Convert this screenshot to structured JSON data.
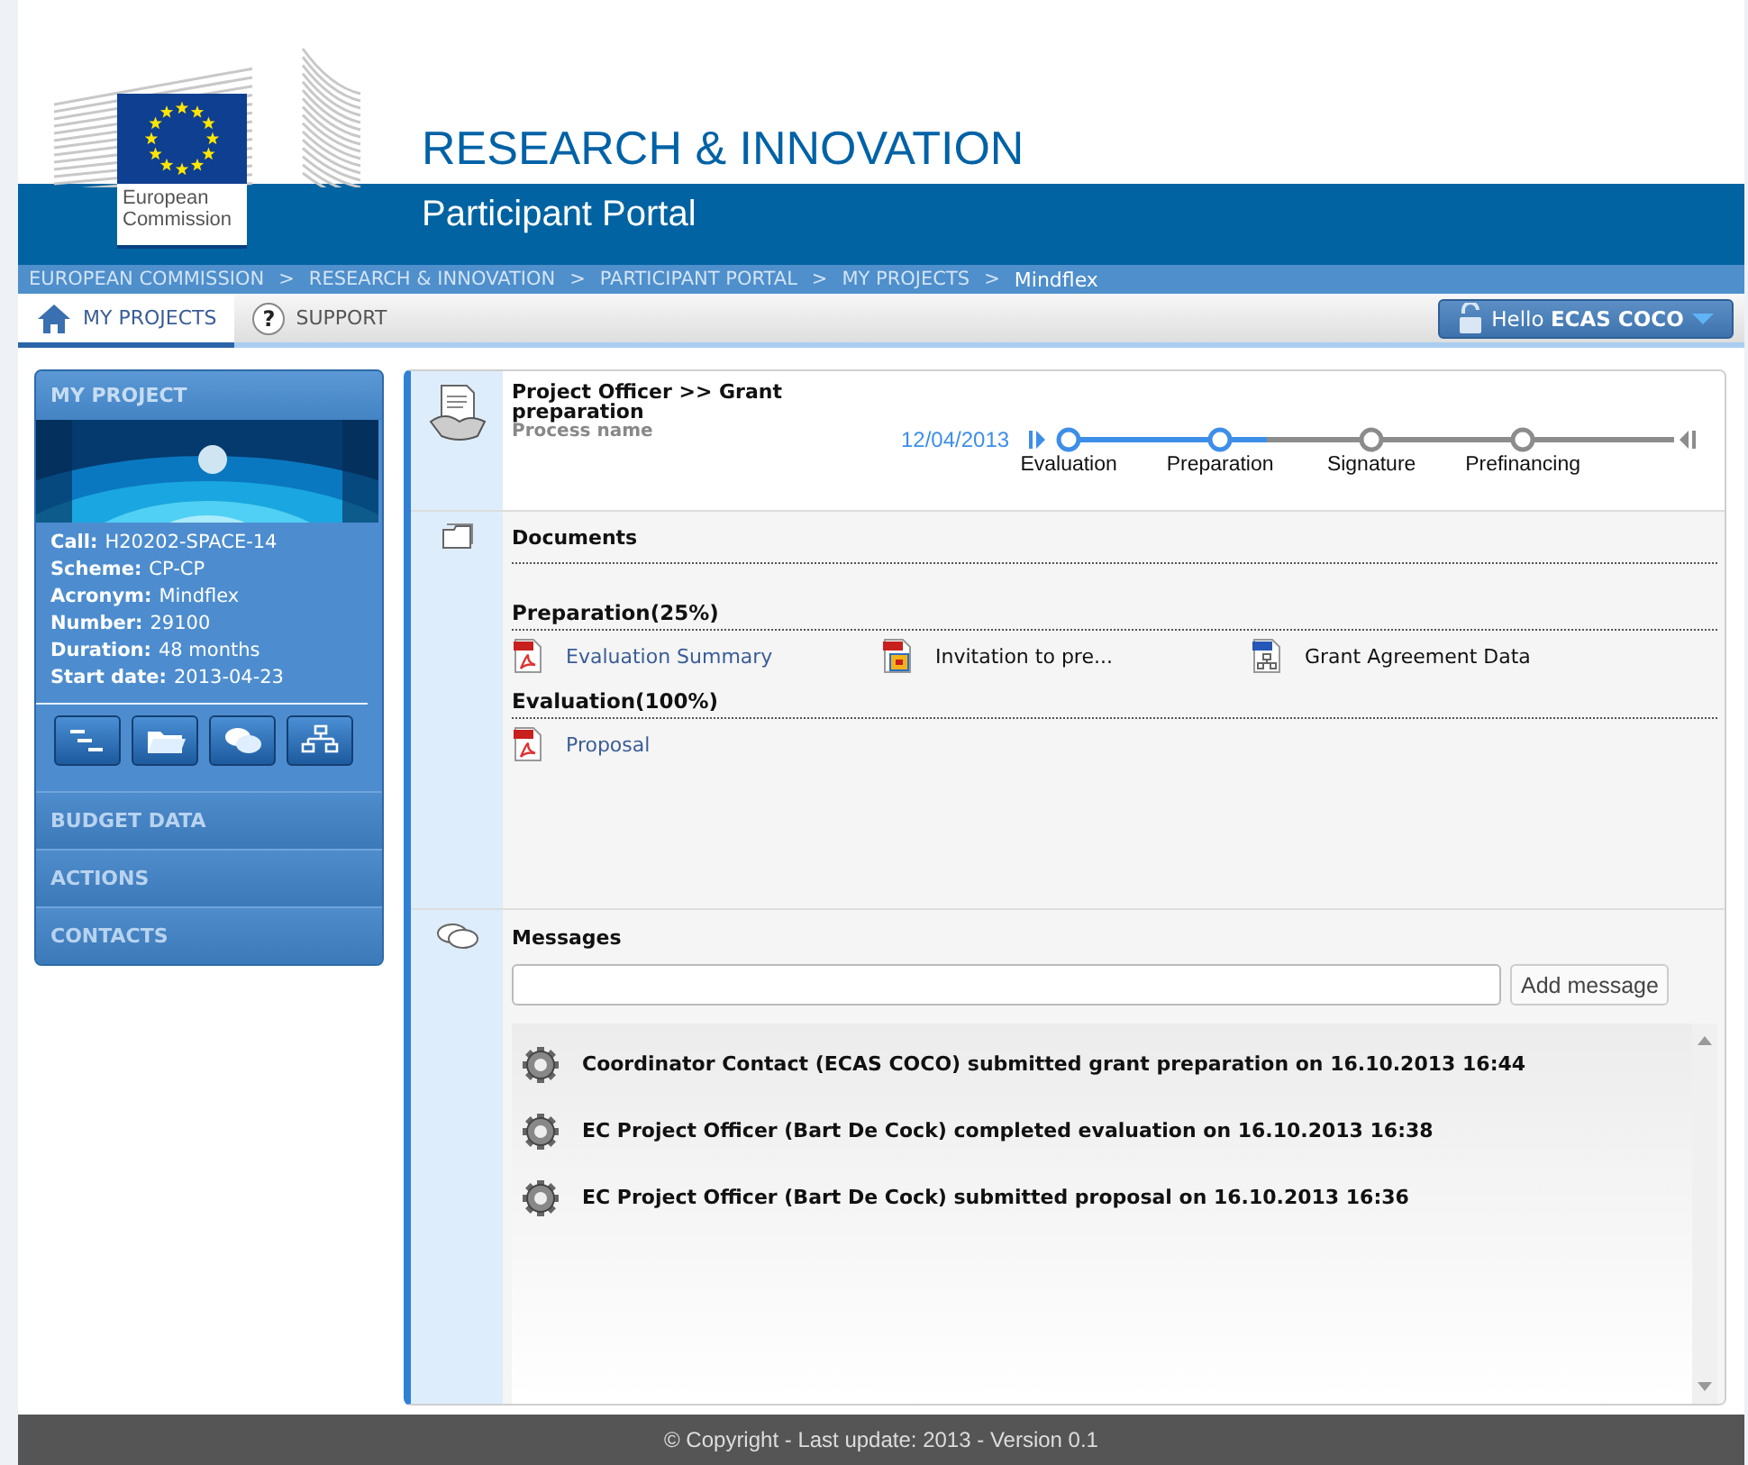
{
  "header": {
    "logo_text": "European Commission",
    "title": "RESEARCH & INNOVATION",
    "subtitle": "Participant Portal"
  },
  "breadcrumb": [
    "EUROPEAN COMMISSION",
    ">",
    "RESEARCH & INNOVATION",
    ">",
    "PARTICIPANT PORTAL",
    ">",
    "MY PROJECTS",
    ">",
    "Mindflex"
  ],
  "tabs": [
    {
      "label": "MY PROJECTS",
      "kind": "home",
      "selected": true
    },
    {
      "label": "SUPPORT",
      "kind": "help",
      "glyph": "?",
      "selected": false
    }
  ],
  "user_menu": {
    "text": "Hello **ECAS COCO**"
  },
  "sidebar": {
    "title": "MY PROJECT",
    "banner": {
      "kind": "picture"
    },
    "fields": [
      {
        "label": "Call:",
        "value": "H20202-SPACE-14"
      },
      {
        "label": "Scheme:",
        "value": "CP-CP"
      },
      {
        "label": "Acronym:",
        "value": "Mindflex"
      },
      {
        "label": "Number:",
        "value": "29100"
      },
      {
        "label": "Duration:",
        "value": "48 months"
      },
      {
        "label": "Start date:",
        "value": "2013-04-23"
      }
    ],
    "tools": [
      {
        "kind": "gantt"
      },
      {
        "kind": "folder"
      },
      {
        "kind": "chat"
      },
      {
        "kind": "chart"
      }
    ],
    "sections": [
      "BUDGET DATA",
      "ACTIONS",
      "CONTACTS"
    ]
  },
  "process": {
    "title": "Project Officer >> Grant preparation",
    "subtitle": "Process name",
    "date": "12/04/2013",
    "stages": [
      {
        "label": "Evaluation",
        "done": true
      },
      {
        "label": "Preparation",
        "done": true
      },
      {
        "label": "Signature",
        "done": false
      },
      {
        "label": "Prefinancing",
        "done": false
      }
    ]
  },
  "documents": {
    "title": "Documents",
    "groups": [
      {
        "title": "Preparation(25%)",
        "items": [
          {
            "name": "Evaluation Summary",
            "kind": "pdf",
            "link": true
          },
          {
            "name": "Invitation to pre...",
            "kind": "bundle",
            "link": false
          },
          {
            "name": "Grant Agreement Data",
            "kind": "data",
            "link": false
          }
        ]
      },
      {
        "title": "Evaluation(100%)",
        "items": [
          {
            "name": "Proposal",
            "kind": "pdf",
            "link": true
          }
        ]
      }
    ]
  },
  "messages": {
    "title": "Messages",
    "button": "Add message",
    "items": [
      "Coordinator Contact (ECAS COCO) submitted grant preparation on 16.10.2013 16:44",
      "EC Project Officer (Bart De Cock) completed evaluation on 16.10.2013 16:38",
      "EC Project Officer (Bart De Cock) submitted proposal on 16.10.2013 16:36"
    ]
  },
  "footer": "© Copyright - Last update: 2013 - Version 0.1"
}
